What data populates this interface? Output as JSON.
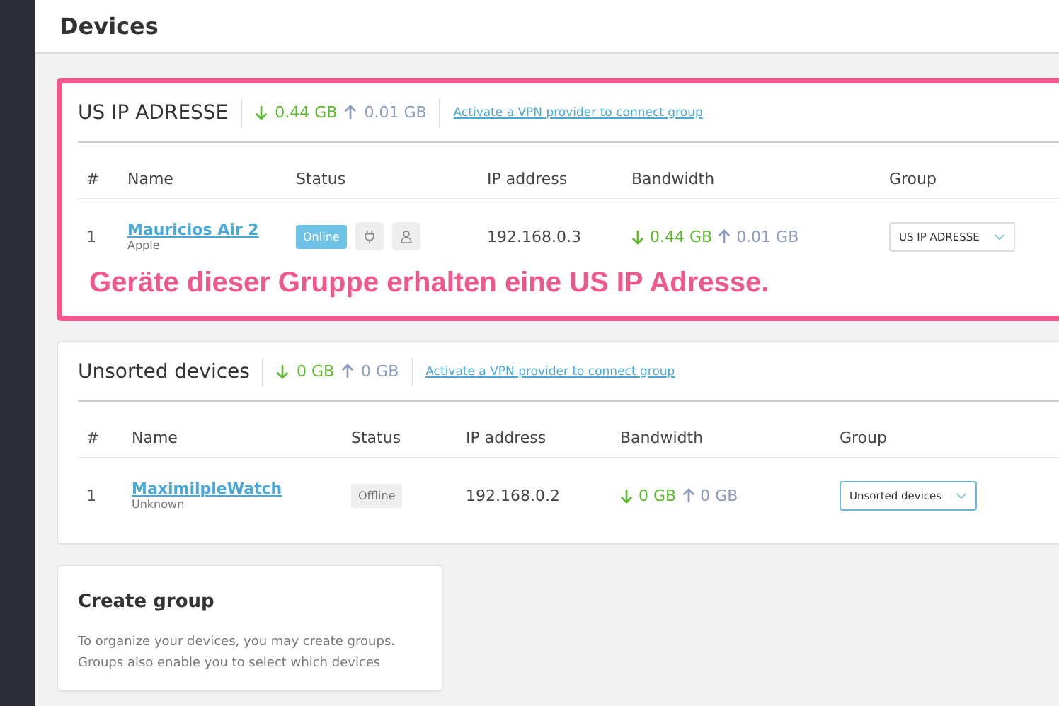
{
  "page": {
    "title": "Devices"
  },
  "groups": [
    {
      "name": "US IP ADRESSE",
      "highlighted": true,
      "down": "0.44 GB",
      "up": "0.01 GB",
      "link": "Activate a VPN provider to connect group",
      "columns": [
        "#",
        "Name",
        "Status",
        "IP address",
        "Bandwidth",
        "Group"
      ],
      "rows": [
        {
          "index": "1",
          "name": "Mauricios Air 2",
          "vendor": "Apple",
          "status": "Online",
          "kind": "online",
          "show_actions": true,
          "ip": "192.168.0.3",
          "down": "0.44 GB",
          "up": "0.01 GB",
          "group": "US IP ADRESSE",
          "focused": false
        }
      ]
    },
    {
      "name": "Unsorted devices",
      "highlighted": false,
      "down": "0 GB",
      "up": "0 GB",
      "link": "Activate a VPN provider to connect group",
      "columns": [
        "#",
        "Name",
        "Status",
        "IP address",
        "Bandwidth",
        "Group"
      ],
      "rows": [
        {
          "index": "1",
          "name": "MaximilpleWatch",
          "vendor": "Unknown",
          "status": "Offline",
          "kind": "offline",
          "show_actions": false,
          "ip": "192.168.0.2",
          "down": "0 GB",
          "up": "0 GB",
          "group": "Unsorted devices",
          "focused": true
        }
      ]
    }
  ],
  "create_group": {
    "title": "Create group",
    "text": "To organize your devices, you may create groups. Groups also enable you to select which devices"
  },
  "annotation": {
    "text": "Geräte dieser Gruppe erhalten eine US IP Adresse."
  }
}
